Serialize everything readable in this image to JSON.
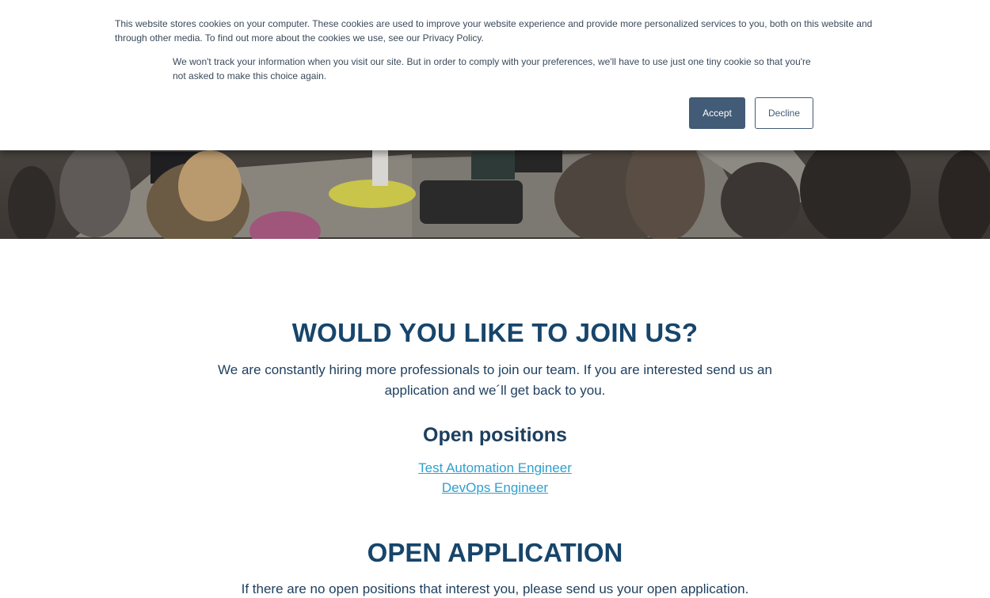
{
  "cookie_banner": {
    "text": "This website stores cookies on your computer. These cookies are used to improve your website experience and provide more personalized services to you, both on this website and through other media. To find out more about the cookies we use, see our Privacy Policy.",
    "text_secondary": "We won't track your information when you visit our site. But in order to comply with your preferences, we'll have to use just one tiny cookie so that you're not asked to make this choice again.",
    "accept_label": "Accept",
    "decline_label": "Decline"
  },
  "hero": {
    "image": "office-team-working-photo"
  },
  "join": {
    "heading": "WOULD YOU LIKE TO JOIN US?",
    "text": "We are constantly hiring more professionals to join our team. If you are interested send us an application and we´ll get back to you."
  },
  "positions": {
    "heading": "Open positions",
    "items": [
      "Test Automation Engineer",
      "DevOps Engineer"
    ]
  },
  "open_application": {
    "heading": "OPEN APPLICATION",
    "text": "If there are no open positions that interest you, please send us your open application."
  },
  "colors": {
    "accent": "#425b76",
    "heading": "#17456b",
    "link": "#2fa0d0"
  }
}
